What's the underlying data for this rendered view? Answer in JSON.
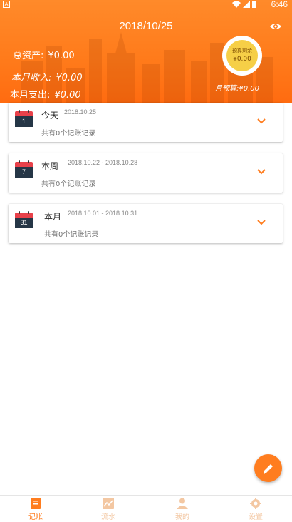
{
  "status_bar": {
    "app_icon_letter": "A",
    "time": "6:46"
  },
  "header": {
    "date": "2018/10/25",
    "total_assets_label": "总资产:",
    "total_assets_value": "¥0.00",
    "month_income_label": "本月收入:",
    "month_income_value": "¥0.00",
    "month_expense_label": "本月支出:",
    "month_expense_value": "¥0.00",
    "budget_remaining_label": "预算剩余",
    "budget_remaining_value": "¥0.00",
    "month_budget_label": "月预算:",
    "month_budget_value": "¥0.00"
  },
  "cards": [
    {
      "cal_day": "1",
      "title": "今天",
      "range": "2018.10.25",
      "count": "共有0个记账记录"
    },
    {
      "cal_day": "7",
      "title": "本周",
      "range": "2018.10.22 - 2018.10.28",
      "count": "共有0个记账记录"
    },
    {
      "cal_day": "31",
      "title": "本月",
      "range": "2018.10.01 - 2018.10.31",
      "count": "共有0个记账记录"
    }
  ],
  "bottom_nav": [
    {
      "label": "记账",
      "icon": "note-icon",
      "active": true
    },
    {
      "label": "流水",
      "icon": "chart-icon",
      "active": false
    },
    {
      "label": "我的",
      "icon": "person-icon",
      "active": false
    },
    {
      "label": "设置",
      "icon": "gear-icon",
      "active": false
    }
  ],
  "colors": {
    "accent": "#ff7d1f",
    "header": "#ff7a1a",
    "budget_circle": "#f6cf47",
    "calendar_red": "#e8414a",
    "calendar_dark": "#253646",
    "nav_inactive": "#f3c7a2"
  }
}
